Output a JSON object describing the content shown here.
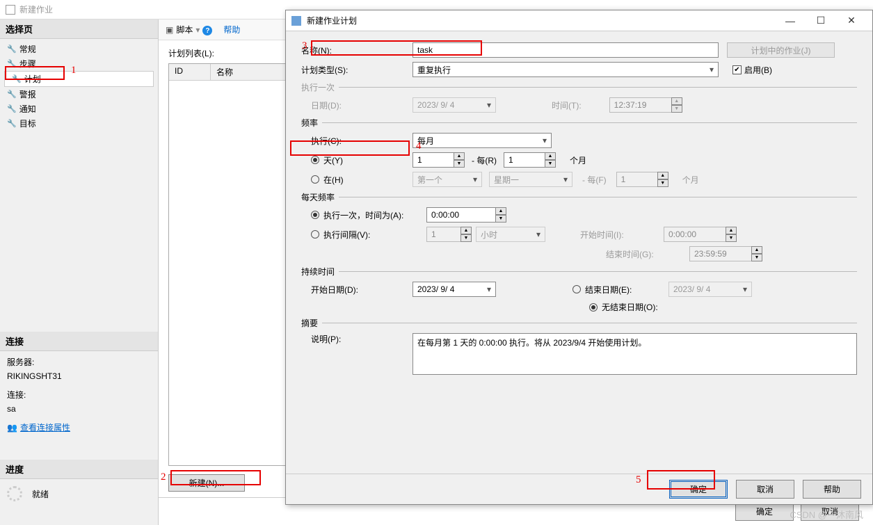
{
  "bg": {
    "title": "新建作业",
    "select_page": "选择页",
    "pages": [
      "常规",
      "步骤",
      "计划",
      "警报",
      "通知",
      "目标"
    ],
    "connection_hdr": "连接",
    "server_lbl": "服务器:",
    "server_val": "RIKINGSHT31",
    "conn_lbl": "连接:",
    "conn_val": "sa",
    "conn_link": "查看连接属性",
    "progress_hdr": "进度",
    "progress_val": "就绪",
    "toolbar_script": "脚本",
    "toolbar_help": "帮助",
    "list_label": "计划列表(L):",
    "col_id": "ID",
    "col_name": "名称",
    "new_btn": "新建(N)...",
    "ok": "确定",
    "cancel": "取消"
  },
  "dlg": {
    "title": "新建作业计划",
    "name_lbl": "名称(N):",
    "name_val": "task",
    "jobs_in_plan": "计划中的作业(J)",
    "type_lbl": "计划类型(S):",
    "type_val": "重复执行",
    "enable_lbl": "启用(B)",
    "once_hdr": "执行一次",
    "date_lbl": "日期(D):",
    "date_val": "2023/ 9/ 4",
    "time_lbl": "时间(T):",
    "time_val": "12:37:19",
    "freq_hdr": "频率",
    "exec_lbl": "执行(C):",
    "exec_val": "每月",
    "day_radio": "天(Y)",
    "on_radio": "在(H)",
    "day_val": "1",
    "every_r": "- 每(R)",
    "every_r_val": "1",
    "month1": "个月",
    "sel_first": "第一个",
    "sel_weekday": "星期一",
    "every_f": "- 每(F)",
    "every_f_val": "1",
    "month2": "个月",
    "daily_hdr": "每天频率",
    "once_at_lbl": "执行一次，时间为(A):",
    "once_at_val": "0:00:00",
    "interval_lbl": "执行间隔(V):",
    "interval_val": "1",
    "interval_unit": "小时",
    "start_time_lbl": "开始时间(I):",
    "start_time_val": "0:00:00",
    "end_time_lbl": "结束时间(G):",
    "end_time_val": "23:59:59",
    "duration_hdr": "持续时间",
    "start_date_lbl": "开始日期(D):",
    "start_date_val": "2023/ 9/ 4",
    "end_date_radio": "结束日期(E):",
    "end_date_val": "2023/ 9/ 4",
    "no_end_radio": "无结束日期(O):",
    "summary_hdr": "摘要",
    "desc_lbl": "说明(P):",
    "desc_val": "在每月第 1 天的 0:00:00 执行。将从 2023/9/4 开始使用计划。",
    "ok": "确定",
    "cancel": "取消",
    "help": "帮助"
  },
  "ann": {
    "n1": "1",
    "n2": "2",
    "n3": "3",
    "n4": "4",
    "n5": "5"
  },
  "watermark": "CSDN @一沐南风"
}
